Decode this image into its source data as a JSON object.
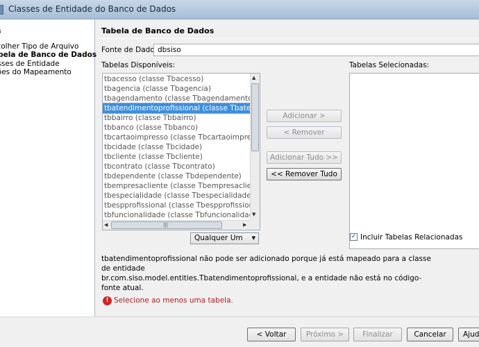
{
  "window": {
    "title": "Classes de Entidade do Banco de Dados"
  },
  "sidebar": {
    "heading": "s",
    "steps": [
      {
        "label": "scolher Tipo de Arquivo",
        "active": false
      },
      {
        "label": "abela de Banco de Dados",
        "active": true
      },
      {
        "label": "asses de Entidade",
        "active": false
      },
      {
        "label": "ções do Mapeamento",
        "active": false
      }
    ]
  },
  "panel": {
    "title": "Tabela de Banco de Dados",
    "datasource_label": "Fonte de Dados:",
    "datasource_value": "dbsiso",
    "available_label": "Tabelas Disponíveis:",
    "selected_label": "Tabelas Selecionadas:",
    "available_tables": [
      "tbacesso (classe Tbacesso)",
      "tbagencia (classe Tbagencia)",
      "tbagendamento (classe Tbagendamento)",
      "tbatendimentoprofissional (classe Tbatendimentoprofissional)",
      "tbbairro (classe Tbbairro)",
      "tbbanco (classe Tbbanco)",
      "tbcartaoimpresso (classe Tbcartaoimpresso)",
      "tbcidade (classe Tbcidade)",
      "tbcliente (classe Tbcliente)",
      "tbcontrato (classe Tbcontrato)",
      "tbdependente (classe Tbdependente)",
      "tbempresacliente (classe Tbempresacliente)",
      "tbespecialidade (classe Tbespecialidade)",
      "tbespprofissional (classe Tbespprofissional)",
      "tbfuncionalidade (classe Tbfuncionalidade)"
    ],
    "selected_index": 3,
    "filter_value": "Qualquer Um",
    "buttons": {
      "add": "Adicionar >",
      "remove": "< Remover",
      "add_all": "Adicionar Tudo >>",
      "remove_all": "<< Remover Tudo"
    },
    "include_related_label": "Incluir Tabelas Relacionadas",
    "include_related_checked": true,
    "info_text_1": "tbatendimentoprofissional não pode ser adicionado porque já está mapeado para a classe de entidade",
    "info_text_2": "br.com.siso.model.entities.Tbatendimentoprofissional, e a entidade não está no código-fonte atual.",
    "error_text": "Selecione ao menos uma tabela."
  },
  "footer": {
    "back": "< Voltar",
    "next": "Próximo >",
    "finish": "Finalizar",
    "cancel": "Cancelar",
    "help": "Ajuda"
  },
  "icons": {
    "scroll_up": "▲",
    "scroll_down": "▼",
    "scroll_left": "◀",
    "scroll_right": "▶",
    "dropdown": "▼",
    "check": "✓",
    "error": "!"
  }
}
